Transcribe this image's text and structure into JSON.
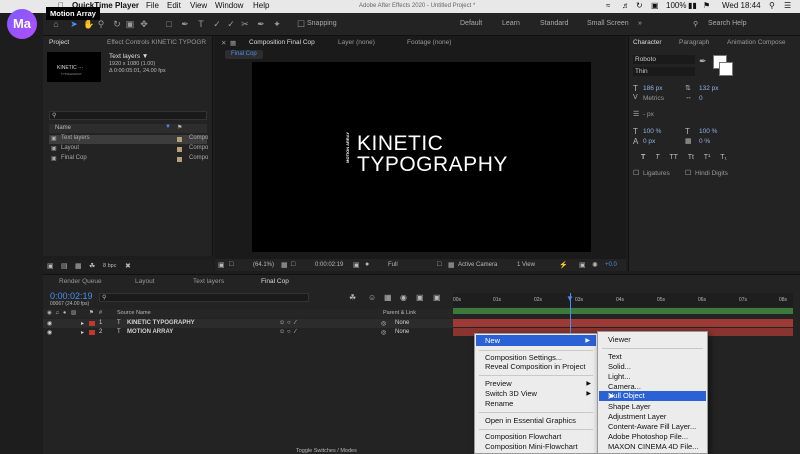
{
  "menubar": {
    "app": "QuickTime Player",
    "items": [
      "File",
      "Edit",
      "View",
      "Window",
      "Help"
    ],
    "center_title": "Adobe After Effects 2020 - Untitled Project *",
    "battery": "100%",
    "clock": "Wed 18:44"
  },
  "overlay": {
    "logo_text": "Ma",
    "label": "Motion Array"
  },
  "toolbar": {
    "snapping": "Snapping",
    "workspaces": [
      "Default",
      "Learn",
      "Standard",
      "Small Screen"
    ],
    "search_placeholder": "Search Help"
  },
  "project": {
    "tab": "Project",
    "effects_tab": "Effect Controls KINETIC TYPOGR",
    "selected_name": "Text layers ▼",
    "selected_size": "1920 x 1080 (1.00)",
    "selected_dur": "Δ 0:00:05:01, 24.00 fps",
    "col_name": "Name",
    "rows": [
      {
        "name": "Text layers",
        "type": "Compo"
      },
      {
        "name": "Layout",
        "type": "Compo"
      },
      {
        "name": "Final Cop",
        "type": "Compo"
      }
    ],
    "bpc": "8 bpc"
  },
  "viewer": {
    "tab": "Composition Final Cop",
    "layer_tab": "Layer (none)",
    "footage_tab": "Footage (none)",
    "comp_chip": "Final Cop",
    "title_line1": "KINETIC",
    "title_line2": "TYPOGRAPHY",
    "vertical": "MOTION ARRAY",
    "zoom": "(64.1%)",
    "timecode": "0:00:02:19",
    "resolution": "Full",
    "camera": "Active Camera",
    "views": "1 View",
    "offset": "+0.0"
  },
  "character": {
    "tab": "Character",
    "paragraph_tab": "Paragraph",
    "animation_tab": "Animation Compose",
    "font": "Roboto",
    "style": "Thin",
    "size": "186 px",
    "leading": "132 px",
    "tracking_label": "Metrics",
    "tracking": "0",
    "stroke": "- px",
    "vscale": "100 %",
    "hscale": "100 %",
    "baseline": "0 px",
    "tsume": "0 %",
    "ligatures": "Ligatures",
    "hindi": "Hindi Digits"
  },
  "timeline": {
    "tabs": [
      "Render Queue",
      "Layout",
      "Text layers",
      "Final Cop"
    ],
    "timecode": "0:00:02:19",
    "frames": "00067 (24.00 fps)",
    "col_source": "Source Name",
    "col_parent": "Parent & Link",
    "layers": [
      {
        "num": "1",
        "name": "KINETIC TYPOGRAPHY",
        "parent": "None"
      },
      {
        "num": "2",
        "name": "MOTION ARRAY",
        "parent": "None"
      }
    ],
    "ruler": [
      "00s",
      "01s",
      "02s",
      "03s",
      "04s",
      "05s",
      "06s",
      "07s",
      "08s"
    ],
    "toggle": "Toggle Switches / Modes"
  },
  "context_menu": {
    "main": [
      {
        "label": "New",
        "submenu": true,
        "highlight": true
      },
      {
        "label": "Composition Settings..."
      },
      {
        "label": "Reveal Composition in Project"
      },
      {
        "label": "Preview",
        "submenu": true
      },
      {
        "label": "Switch 3D View",
        "submenu": true
      },
      {
        "label": "Rename"
      },
      {
        "label": "Open in Essential Graphics"
      },
      {
        "label": "Composition Flowchart"
      },
      {
        "label": "Composition Mini-Flowchart"
      }
    ],
    "sub": [
      {
        "label": "Viewer"
      },
      {
        "label": "Text"
      },
      {
        "label": "Solid..."
      },
      {
        "label": "Light..."
      },
      {
        "label": "Camera..."
      },
      {
        "label": "Null Object",
        "highlight": true
      },
      {
        "label": "Shape Layer"
      },
      {
        "label": "Adjustment Layer"
      },
      {
        "label": "Content-Aware Fill Layer..."
      },
      {
        "label": "Adobe Photoshop File..."
      },
      {
        "label": "MAXON CINEMA 4D File..."
      }
    ]
  },
  "colors": {
    "accent_blue": "#2a62d6",
    "layer_red": "#c0392b",
    "timecode_blue": "#4a8ef0"
  }
}
